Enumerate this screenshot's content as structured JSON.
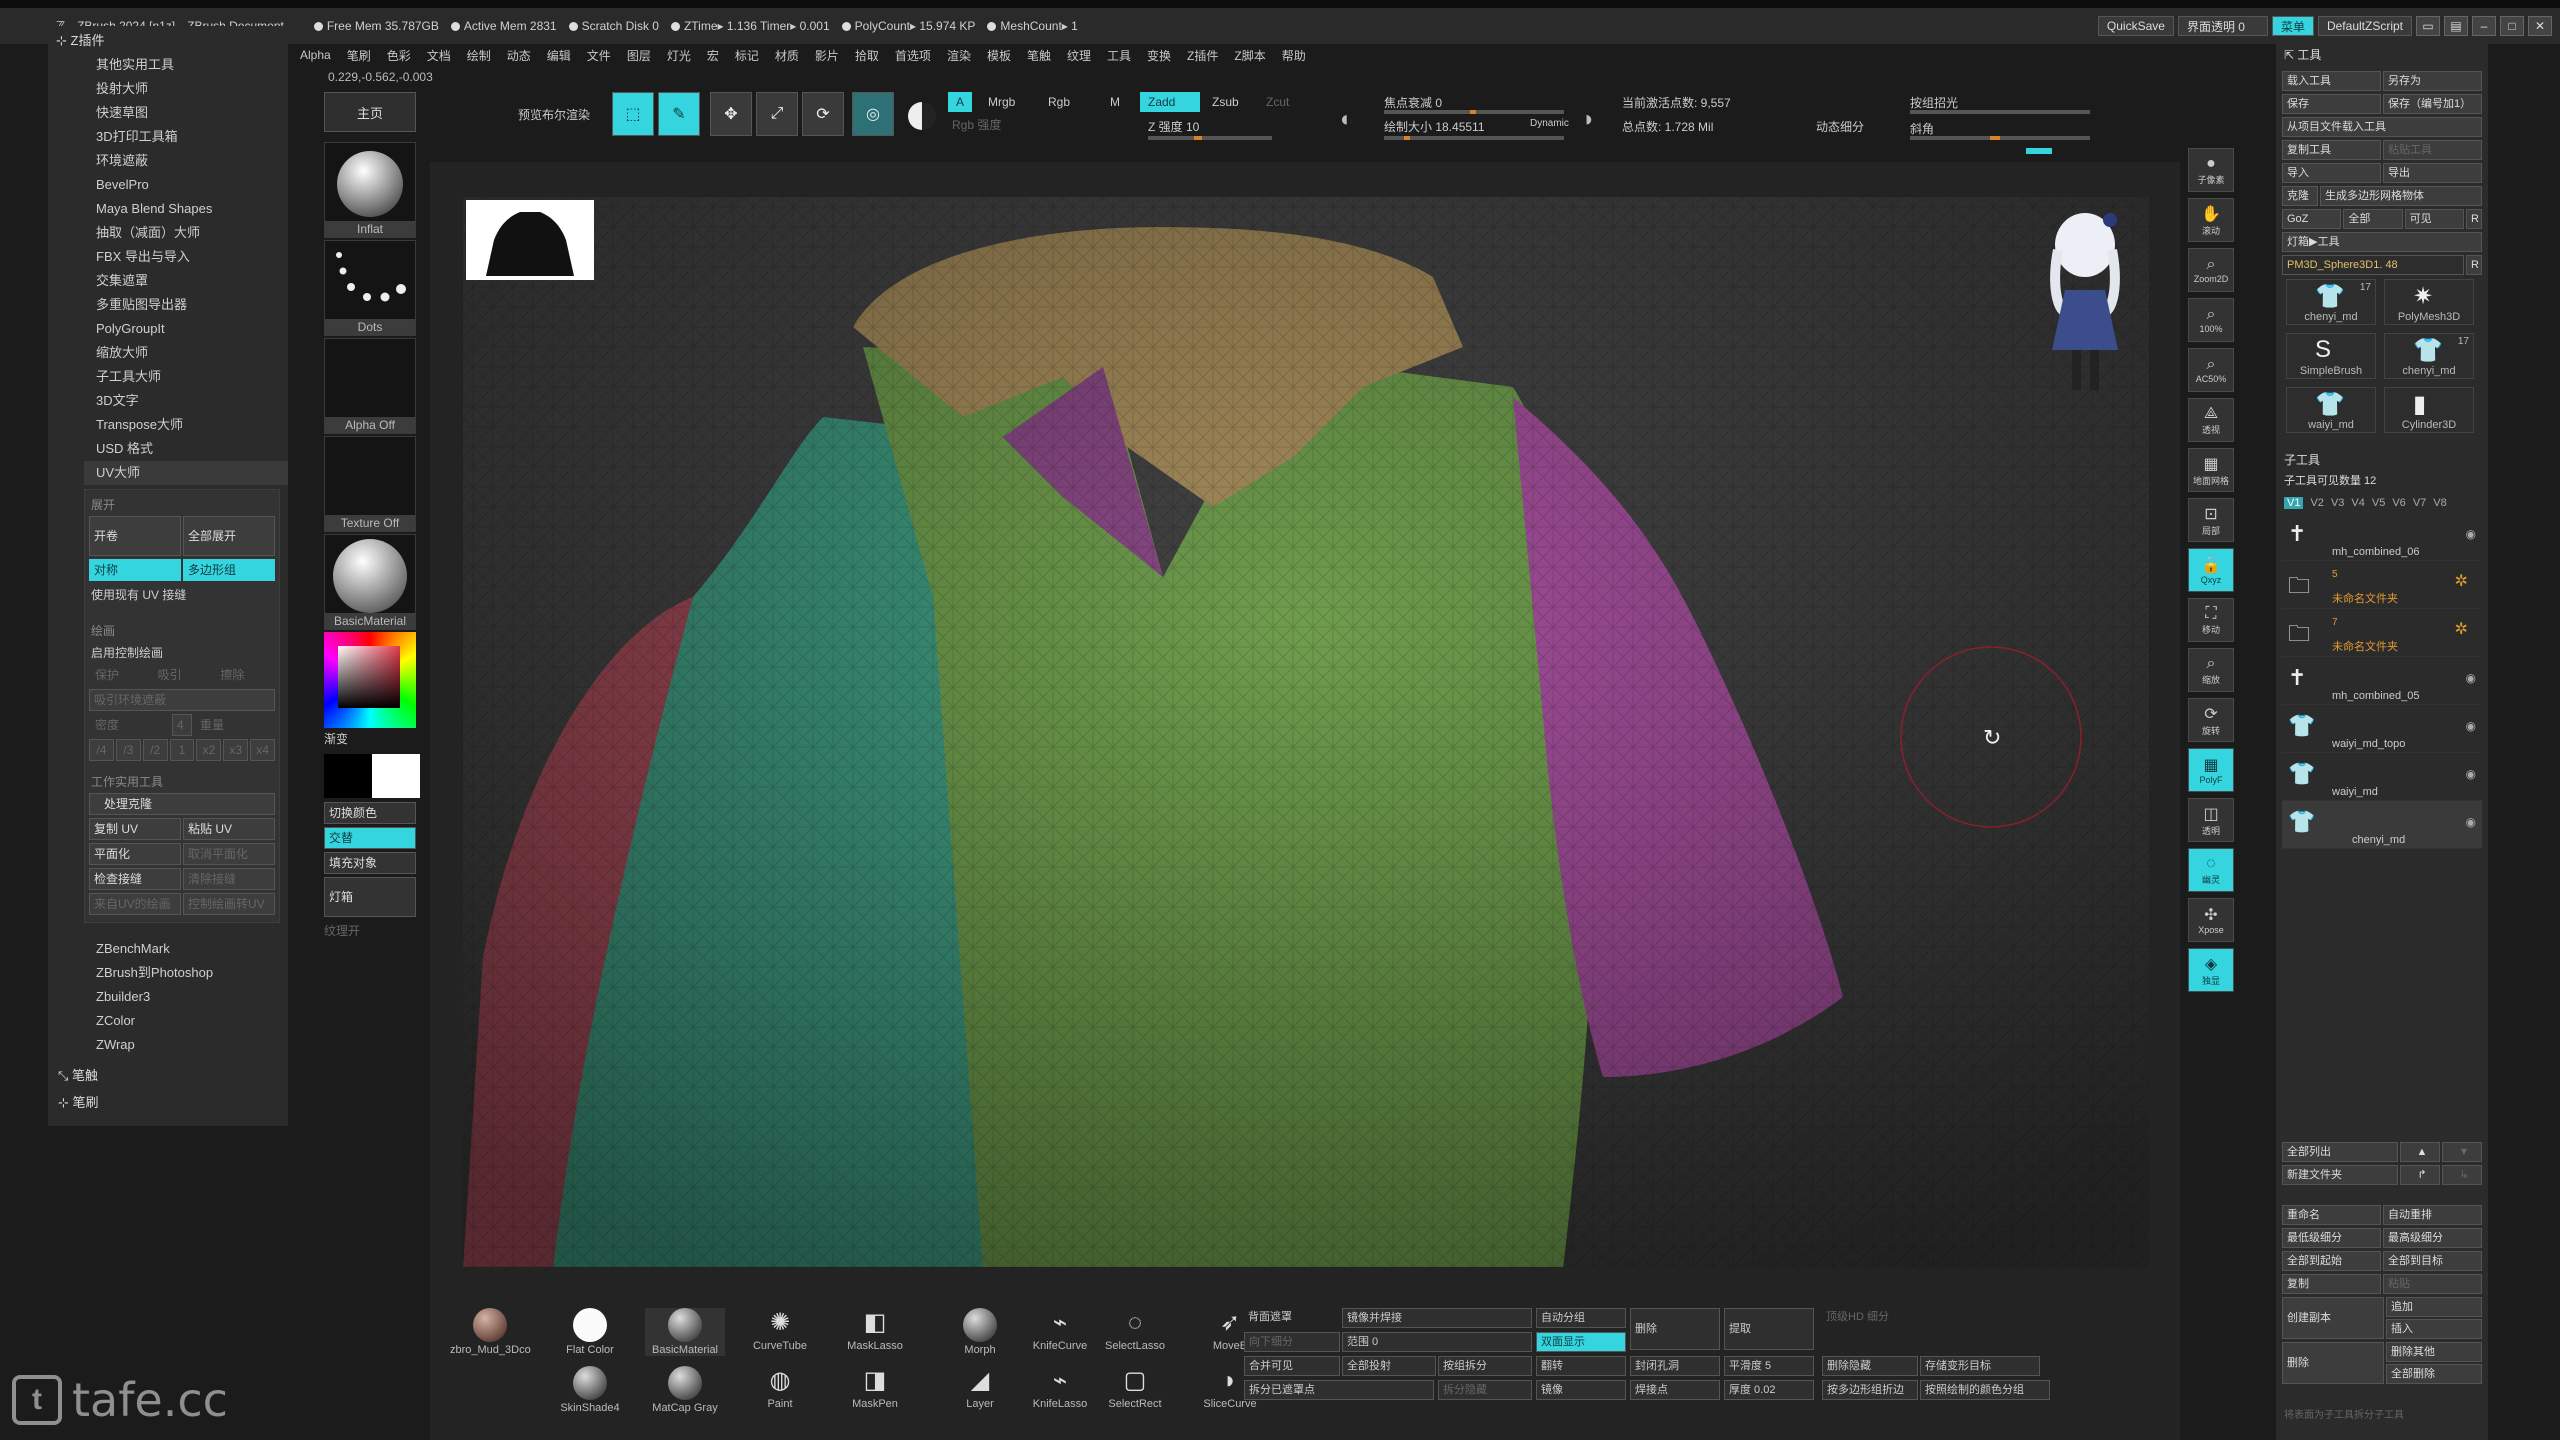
{
  "titlebar": {
    "app": "ZBrush 2024 [n1z]",
    "doc": "ZBrush Document",
    "free_mem": "Free Mem 35.787GB",
    "active_mem": "Active Mem 2831",
    "scratch": "Scratch Disk 0",
    "ztime": "ZTime▸ 1.136 Timer▸ 0.001",
    "polycount": "PolyCount▸ 15.974 KP",
    "meshcount": "MeshCount▸ 1",
    "quicksave": "QuickSave",
    "transparency": "界面透明 0",
    "menu_btn": "菜单",
    "zscript": "DefaultZScript"
  },
  "menubar": [
    "Alpha",
    "笔刷",
    "色彩",
    "文档",
    "绘制",
    "动态",
    "编辑",
    "文件",
    "图层",
    "灯光",
    "宏",
    "标记",
    "材质",
    "影片",
    "拾取",
    "首选项",
    "渲染",
    "模板",
    "笔触",
    "纹理",
    "工具",
    "变换",
    "Z插件",
    "Z脚本",
    "帮助"
  ],
  "coords": "0.229,-0.562,-0.003",
  "left_panel": {
    "header": "Z插件",
    "items": [
      "其他实用工具",
      "投射大师",
      "快速草图",
      "3D打印工具箱",
      "环境遮蔽",
      "BevelPro",
      "Maya Blend Shapes",
      "抽取（减面）大师",
      "FBX 导出与导入",
      "交集遮罩",
      "多重贴图导出器",
      "PolyGroupIt",
      "缩放大师",
      "子工具大师",
      "3D文字",
      "Transpose大师",
      "USD 格式",
      "UV大师"
    ],
    "uv": {
      "sec_unwrap": "展开",
      "unwrap": "开卷",
      "unwrap_all": "全部展开",
      "symmetry": "对称",
      "polygroups": "多边形组",
      "use_existing": "使用现有 UV 接缝",
      "sec_paint": "绘画",
      "enable_paint": "启用控制绘画",
      "protect": "保护",
      "attract": "吸引",
      "erase": "擦除",
      "paint_ao": "吸引环境遮蔽",
      "density": "密度",
      "density_val": "4",
      "seam": "重量",
      "density_opts": [
        "/4",
        "/3",
        "/2",
        "1",
        "x2",
        "x3",
        "x4"
      ],
      "sec_work": "工作实用工具",
      "work_on_clone": "处理克隆",
      "copy_uv": "复制 UV",
      "paste_uv": "粘贴 UV",
      "flatten": "平面化",
      "unflatten": "取消平面化",
      "check_seams": "检查接缝",
      "clear_seams": "清除接缝",
      "polypaint_from_uv": "来自UV的绘画",
      "uv_from_polypaint": "控制绘画转UV"
    },
    "tail": [
      "ZBenchMark",
      "ZBrush到Photoshop",
      "Zbuilder3",
      "ZColor",
      "ZWrap"
    ],
    "stroke": "笔触",
    "brush": "笔刷"
  },
  "brush_col": {
    "home": "主页",
    "inflat": "Inflat",
    "dots": "Dots",
    "alpha_off": "Alpha Off",
    "texture_off": "Texture Off",
    "material": "BasicMaterial",
    "gradient": "渐变",
    "switch_color": "切换颜色",
    "alternate": "交替",
    "fill_object": "填充对象",
    "lightbox": "灯箱",
    "texture_on": "纹理开"
  },
  "shelf": {
    "preview_boolean": "预览布尔渲染",
    "edit": "Edit",
    "draw": "绘制",
    "move": "移动",
    "scale": "缩放",
    "rotate": "旋转",
    "a": "A",
    "mrgb": "Mrgb",
    "rgb": "Rgb",
    "m": "M",
    "zadd": "Zadd",
    "zsub": "Zsub",
    "zcut": "Zcut",
    "rgb_intensity": "Rgb 强度",
    "z_intensity": "Z 强度 10",
    "focal_shift": "焦点衰减 0",
    "draw_size": "绘制大小 18.45511",
    "dynamic": "Dynamic",
    "active_points": "当前激活点数: 9,557",
    "total_points": "总点数: 1.728 Mil",
    "dyn_subdiv": "动态细分",
    "smooth_by_group": "按组招光",
    "bevel": "斜角"
  },
  "right_strip": [
    {
      "icon": "material-sphere-icon",
      "label": "子像素"
    },
    {
      "icon": "hand-icon",
      "label": "滚动"
    },
    {
      "icon": "zoom2d-icon",
      "label": "Zoom2D"
    },
    {
      "icon": "zoom100-icon",
      "label": "100%"
    },
    {
      "icon": "ac50-icon",
      "label": "AC50%"
    },
    {
      "icon": "dynamic-icon",
      "label": "透视"
    },
    {
      "icon": "floor-icon",
      "label": "地面网格"
    },
    {
      "icon": "local-icon",
      "label": "局部"
    },
    {
      "icon": "lock-icon",
      "label": "Qxyz"
    },
    {
      "icon": "frame-icon",
      "label": "移动"
    },
    {
      "icon": "zoom3d-icon",
      "label": "缩放"
    },
    {
      "icon": "rotate-icon",
      "label": "旋转"
    },
    {
      "icon": "polyf-icon",
      "label": "PolyF"
    },
    {
      "icon": "transp-icon",
      "label": "透明"
    },
    {
      "icon": "ghost-icon",
      "label": "幽灵"
    },
    {
      "icon": "xpose-icon",
      "label": "Xpose"
    },
    {
      "icon": "solo-icon",
      "label": "独显"
    }
  ],
  "tool_panel": {
    "title": "工具",
    "load": "载入工具",
    "save_as": "另存为",
    "save": "保存",
    "save_inc": "保存（编号加1）",
    "load_project": "从项目文件载入工具",
    "copy": "复制工具",
    "paste": "粘贴工具",
    "import": "导入",
    "export": "导出",
    "clone": "克隆",
    "make_polymesh": "生成多边形网格物体",
    "goz": "GoZ",
    "all": "全部",
    "visible": "可见",
    "r": "R",
    "lightbox_tools": "灯箱▶工具",
    "current": "PM3D_Sphere3D1. 48",
    "thumbs": [
      {
        "name": "chenyi_md",
        "count": "17"
      },
      {
        "name": "PolyMesh3D",
        "count": ""
      },
      {
        "name": "SimpleBrush",
        "count": ""
      },
      {
        "name": "chenyi_md",
        "count": "17"
      },
      {
        "name": "waiyi_md",
        "count": ""
      },
      {
        "name": "Cylinder3D",
        "count": ""
      }
    ],
    "subtool": "子工具",
    "visible_count": "子工具可见数量 12",
    "vtabs": [
      "V1",
      "V2",
      "V3",
      "V4",
      "V5",
      "V6",
      "V7",
      "V8"
    ],
    "subtools": [
      {
        "name": "mh_combined_06",
        "type": "mesh"
      },
      {
        "name": "未命名文件夹",
        "type": "folder",
        "num": "5"
      },
      {
        "name": "未命名文件夹",
        "type": "folder",
        "num": "7"
      },
      {
        "name": "mh_combined_05",
        "type": "mesh"
      },
      {
        "name": "waiyi_md_topo",
        "type": "mesh"
      },
      {
        "name": "waiyi_md",
        "type": "mesh"
      },
      {
        "name": "chenyi_md",
        "type": "mesh"
      }
    ],
    "list_all": "全部列出",
    "new_folder": "新建文件夹",
    "rename": "重命名",
    "auto_reorder": "自动重排",
    "lowest_subdiv": "最低级细分",
    "highest_subdiv": "最高级细分",
    "all_to_start": "全部到起始",
    "all_to_target": "全部到目标",
    "duplicate": "复制",
    "paste2": "粘贴",
    "append": "追加",
    "insert": "插入",
    "create_copy": "创建副本",
    "delete": "删除",
    "delete_other": "删除其他",
    "delete_all": "全部删除",
    "footnote": "将表面为子工具拆分子工具"
  },
  "dock": {
    "items": [
      {
        "label": "zbro_Mud_3Dco",
        "kind": "ball"
      },
      {
        "label": "Flat Color",
        "kind": "ball"
      },
      {
        "label": "BasicMaterial",
        "kind": "ball"
      },
      {
        "label": "CurveTube",
        "kind": "icon"
      },
      {
        "label": "MaskLasso",
        "kind": "icon"
      },
      {
        "label": "Morph",
        "kind": "ball"
      },
      {
        "label": "KnifeCurve",
        "kind": "icon"
      },
      {
        "label": "SelectLasso",
        "kind": "icon"
      },
      {
        "label": "MoveB",
        "kind": "icon"
      },
      {
        "label": "SkinShade4",
        "kind": "ball"
      },
      {
        "label": "MatCap Gray",
        "kind": "ball"
      },
      {
        "label": "Paint",
        "kind": "icon"
      },
      {
        "label": "MaskPen",
        "kind": "icon"
      },
      {
        "label": "Layer",
        "kind": "icon"
      },
      {
        "label": "KnifeLasso",
        "kind": "icon"
      },
      {
        "label": "SelectRect",
        "kind": "icon"
      },
      {
        "label": "SliceCurve",
        "kind": "icon"
      }
    ],
    "backface": "背面遮罩",
    "mirror_weld": "镜像并焊接",
    "auto_group": "自动分组",
    "delete": "删除",
    "extract": "提取",
    "hd_subdiv": "顶级HD 细分",
    "prev_subdiv": "向下细分",
    "range": "范围 0",
    "double": "双面显示",
    "merge_visible": "合并可见",
    "all_project": "全部投射",
    "split_groups": "按组拆分",
    "flip": "翻转",
    "close_holes": "封闭孔洞",
    "smooth": "平滑度 5",
    "delete_hidden": "删除隐藏",
    "store_morph": "存储变形目标",
    "split_masked": "拆分已遮罩点",
    "split_unmasked": "拆分隐藏",
    "mirror": "镜像",
    "weld_points": "焊接点",
    "thickness": "厚度 0.02",
    "polygroup_border": "按多边形组折边",
    "polypaint_group": "按照绘制的颜色分组"
  },
  "watermark": "tafe.cc"
}
